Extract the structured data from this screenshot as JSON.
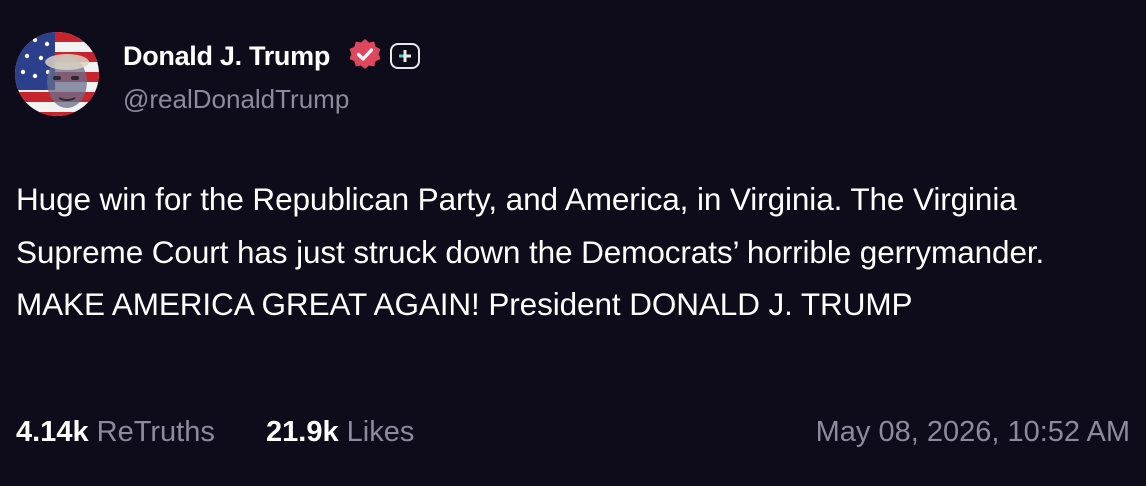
{
  "author": {
    "display_name": "Donald J. Trump",
    "handle": "@realDonaldTrump",
    "verified_icon": "verified-badge-icon",
    "plus_icon": "truth-plus-icon"
  },
  "post": {
    "text": "Huge win for the Republican Party, and America, in Virginia. The Virginia Supreme Court has just struck down the Democrats’ horrible gerrymander. MAKE AMERICA GREAT AGAIN! President DONALD J. TRUMP",
    "retruths_count": "4.14k",
    "retruths_label": "ReTruths",
    "likes_count": "21.9k",
    "likes_label": "Likes",
    "timestamp": "May 08, 2026, 10:52 AM"
  },
  "colors": {
    "background": "#0e0c1b",
    "muted_text": "#8c8a9c",
    "verified_badge": "#e0475e"
  }
}
